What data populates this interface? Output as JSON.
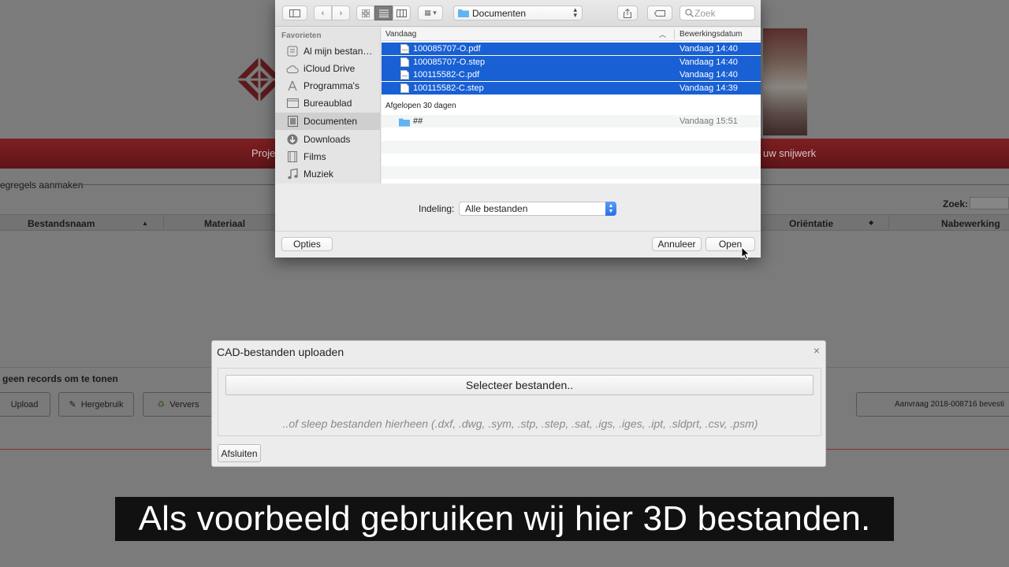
{
  "background_page": {
    "nav_left_text": "Proje",
    "nav_right_text": "uw snijwerk",
    "step_text": "egregels aanmaken",
    "search_label": "Zoek:",
    "table_headers": [
      "Bestandsnaam",
      "Materiaal",
      "Oriëntatie",
      "Nabewerking"
    ],
    "no_records": "geen records om te tonen",
    "buttons": {
      "upload": "Upload",
      "reuse": "Hergebruik",
      "refresh": "Ververs"
    },
    "request_label": "Aanvraag 2018-008716 bevesti"
  },
  "file_dialog": {
    "location": "Documenten",
    "search_placeholder": "Zoek",
    "sidebar_header": "Favorieten",
    "sidebar_items": [
      {
        "label": "Al mijn bestan…",
        "icon": "all-files-icon"
      },
      {
        "label": "iCloud Drive",
        "icon": "cloud-icon"
      },
      {
        "label": "Programma's",
        "icon": "applications-icon"
      },
      {
        "label": "Bureaublad",
        "icon": "desktop-icon"
      },
      {
        "label": "Documenten",
        "icon": "documents-icon"
      },
      {
        "label": "Downloads",
        "icon": "downloads-icon"
      },
      {
        "label": "Films",
        "icon": "films-icon"
      },
      {
        "label": "Muziek",
        "icon": "music-icon"
      }
    ],
    "columns": {
      "name": "Vandaag",
      "date": "Bewerkingsdatum"
    },
    "files_today": [
      {
        "name": "100085707-O.pdf",
        "date": "Vandaag 14:40"
      },
      {
        "name": "100085707-O.step",
        "date": "Vandaag 14:40"
      },
      {
        "name": "100115582-C.pdf",
        "date": "Vandaag 14:40"
      },
      {
        "name": "100115582-C.step",
        "date": "Vandaag 14:39"
      }
    ],
    "group_label": "Afgelopen 30 dagen",
    "folder": {
      "name": "##",
      "date": "Vandaag 15:51"
    },
    "format_label": "Indeling:",
    "format_value": "Alle bestanden",
    "options_button": "Opties",
    "cancel_button": "Annuleer",
    "open_button": "Open",
    "colors": {
      "selection": "#1860d4",
      "accent": "#2a6fe6"
    }
  },
  "cad_dialog": {
    "title": "CAD-bestanden uploaden",
    "close_glyph": "×",
    "select_button": "Selecteer bestanden..",
    "hint": "..of sleep bestanden hierheen (.dxf, .dwg, .sym, .stp, .step, .sat, .igs, .iges, .ipt, .sldprt, .csv, .psm)",
    "close_button": "Afsluiten"
  },
  "subtitle": "Als voorbeeld gebruiken wij hier 3D bestanden."
}
